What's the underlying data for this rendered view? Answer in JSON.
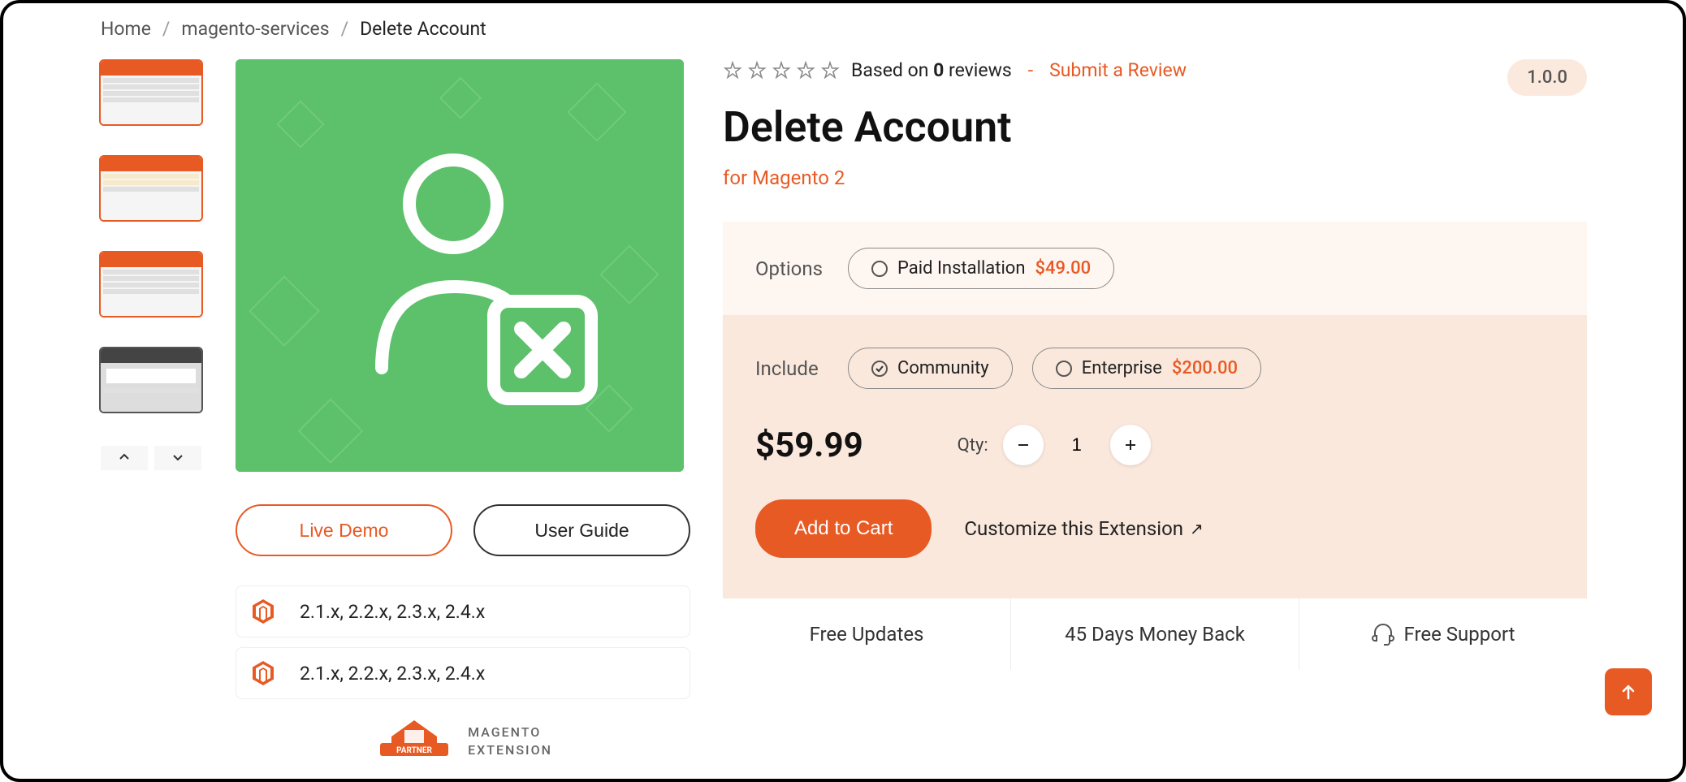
{
  "breadcrumb": {
    "home": "Home",
    "category": "magento-services",
    "current": "Delete Account"
  },
  "product": {
    "title": "Delete Account",
    "subtitle": "for Magento 2",
    "version": "1.0.0",
    "price": "$59.99"
  },
  "reviews": {
    "text_prefix": "Based on ",
    "count": "0",
    "text_suffix": " reviews",
    "submit": "Submit a Review"
  },
  "actions": {
    "live_demo": "Live Demo",
    "user_guide": "User Guide"
  },
  "compat": {
    "line1": "2.1.x, 2.2.x, 2.3.x, 2.4.x",
    "line2": "2.1.x, 2.2.x, 2.3.x, 2.4.x"
  },
  "partner": {
    "badge": "PARTNER",
    "line1": "MAGENTO",
    "line2": "EXTENSION"
  },
  "options": {
    "label": "Options",
    "paid_install": {
      "label": "Paid Installation",
      "price": "$49.00"
    }
  },
  "include": {
    "label": "Include",
    "community": {
      "label": "Community"
    },
    "enterprise": {
      "label": "Enterprise",
      "price": "$200.00"
    }
  },
  "qty": {
    "label": "Qty:",
    "value": "1"
  },
  "cart": {
    "add": "Add to Cart",
    "customize": "Customize this Extension"
  },
  "benefits": {
    "updates": "Free Updates",
    "money_back": "45 Days Money Back",
    "support": "Free Support"
  }
}
